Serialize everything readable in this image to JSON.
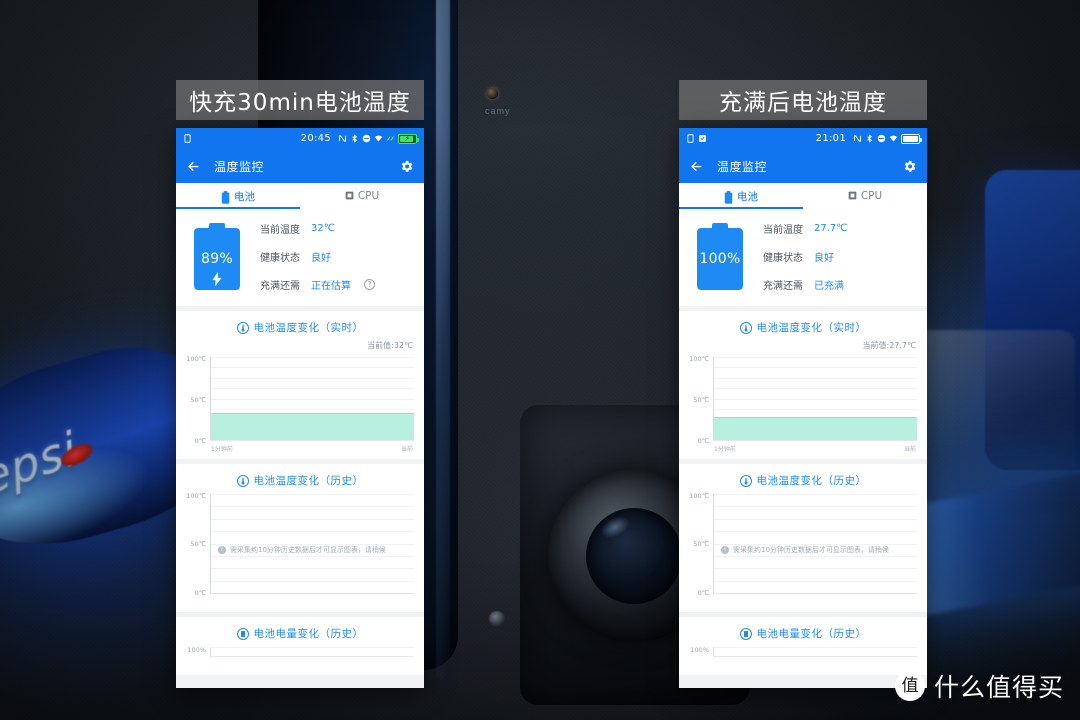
{
  "captions": {
    "left": "快充30min电池温度",
    "right": "充满后电池温度"
  },
  "phones": [
    {
      "id": "left",
      "statusbar": {
        "time": "20:45",
        "left_icons": [
          "sim-card-icon"
        ],
        "right_icons": [
          "nfc-icon",
          "bluetooth-icon",
          "do-not-disturb-icon",
          "wifi-icon",
          "signal-icon"
        ],
        "battery_state": "charging",
        "battery_level_text": "89"
      },
      "appbar": {
        "back_icon": "back-arrow-icon",
        "title": "温度监控",
        "settings_icon": "gear-icon"
      },
      "tabs": [
        {
          "label": "电池",
          "icon": "battery-icon",
          "active": true
        },
        {
          "label": "CPU",
          "icon": "cpu-icon",
          "active": false
        }
      ],
      "battery_card": {
        "percent": "89%",
        "charging": true,
        "rows": [
          {
            "label": "当前温度",
            "value": "32℃",
            "help": false
          },
          {
            "label": "健康状态",
            "value": "良好",
            "help": false
          },
          {
            "label": "充满还需",
            "value": "正在估算",
            "help": true,
            "help_glyph": "?"
          }
        ]
      },
      "realtime_chart": {
        "title": "电池温度变化（实时）",
        "title_icon": "thermometer-icon",
        "current_label": "当前值:32℃",
        "y_ticks": [
          "100℃",
          "50℃",
          "0℃"
        ],
        "x_ticks": {
          "left": "1分钟前",
          "right": "当前"
        }
      },
      "history_chart": {
        "title": "电池温度变化（历史）",
        "title_icon": "thermometer-icon",
        "y_ticks": [
          "100℃",
          "50℃",
          "0℃"
        ],
        "notice": "需采集约10分钟历史数据后才可显示图表，请稍候",
        "notice_icon": "info-icon"
      },
      "level_chart": {
        "title": "电池电量变化（历史）",
        "title_icon": "battery-icon",
        "y_ticks": [
          "100%"
        ]
      }
    },
    {
      "id": "right",
      "statusbar": {
        "time": "21:01",
        "left_icons": [
          "sim-card-icon",
          "save-icon"
        ],
        "right_icons": [
          "nfc-icon",
          "bluetooth-icon",
          "do-not-disturb-icon",
          "wifi-icon"
        ],
        "battery_state": "full",
        "battery_level_text": "100"
      },
      "appbar": {
        "back_icon": "back-arrow-icon",
        "title": "温度监控",
        "settings_icon": "gear-icon"
      },
      "tabs": [
        {
          "label": "电池",
          "icon": "battery-icon",
          "active": true
        },
        {
          "label": "CPU",
          "icon": "cpu-icon",
          "active": false
        }
      ],
      "battery_card": {
        "percent": "100%",
        "charging": false,
        "rows": [
          {
            "label": "当前温度",
            "value": "27.7℃",
            "help": false
          },
          {
            "label": "健康状态",
            "value": "良好",
            "help": false
          },
          {
            "label": "充满还需",
            "value": "已充满",
            "help": false
          }
        ]
      },
      "realtime_chart": {
        "title": "电池温度变化（实时）",
        "title_icon": "thermometer-icon",
        "current_label": "当前值:27.7℃",
        "y_ticks": [
          "100℃",
          "50℃",
          "0℃"
        ],
        "x_ticks": {
          "left": "1分钟前",
          "right": "当前"
        }
      },
      "history_chart": {
        "title": "电池温度变化（历史）",
        "title_icon": "thermometer-icon",
        "y_ticks": [
          "100℃",
          "50℃",
          "0℃"
        ],
        "notice": "需采集约10分钟历史数据后才可显示图表，请稍候",
        "notice_icon": "info-icon"
      },
      "level_chart": {
        "title": "电池电量变化（历史）",
        "title_icon": "battery-icon",
        "y_ticks": [
          "100%"
        ]
      }
    }
  ],
  "background": {
    "pepsi_label": "pepsi",
    "phone_brand": "camy"
  },
  "watermark": {
    "badge": "值",
    "text": "什么值得买"
  },
  "colors": {
    "accent_blue": "#1175f0",
    "value_blue": "#1e8bf5",
    "area_green": "#b8f0e0",
    "caption_bg": "#6e6e6e"
  },
  "chart_data": [
    {
      "type": "area",
      "title": "电池温度变化（实时）",
      "phone": "left",
      "xlabel": "",
      "ylabel": "℃",
      "ylim": [
        0,
        100
      ],
      "y_ticks": [
        0,
        50,
        100
      ],
      "x_ticks": [
        "1分钟前",
        "当前"
      ],
      "series": [
        {
          "name": "电池温度",
          "values": [
            32,
            32,
            32,
            32,
            32,
            32,
            32,
            32,
            32,
            32,
            32,
            32
          ]
        }
      ],
      "current_value": 32,
      "grid": true,
      "legend": "none"
    },
    {
      "type": "area",
      "title": "电池温度变化（实时）",
      "phone": "right",
      "xlabel": "",
      "ylabel": "℃",
      "ylim": [
        0,
        100
      ],
      "y_ticks": [
        0,
        50,
        100
      ],
      "x_ticks": [
        "1分钟前",
        "当前"
      ],
      "series": [
        {
          "name": "电池温度",
          "values": [
            27.7,
            27.7,
            27.7,
            27.7,
            27.7,
            27.7,
            27.7,
            27.7,
            27.7,
            27.7,
            27.7,
            27.7
          ]
        }
      ],
      "current_value": 27.7,
      "grid": true,
      "legend": "none"
    },
    {
      "type": "area",
      "title": "电池温度变化（历史）",
      "phone": "left",
      "ylim": [
        0,
        100
      ],
      "y_ticks": [
        0,
        50,
        100
      ],
      "series": [],
      "annotation": "需采集约10分钟历史数据后才可显示图表，请稍候",
      "grid": true,
      "legend": "none"
    },
    {
      "type": "area",
      "title": "电池温度变化（历史）",
      "phone": "right",
      "ylim": [
        0,
        100
      ],
      "y_ticks": [
        0,
        50,
        100
      ],
      "series": [],
      "annotation": "需采集约10分钟历史数据后才可显示图表，请稍候",
      "grid": true,
      "legend": "none"
    },
    {
      "type": "area",
      "title": "电池电量变化（历史）",
      "phone": "left",
      "ylim": [
        0,
        100
      ],
      "y_ticks": [
        100
      ],
      "series": [],
      "grid": true,
      "legend": "none"
    },
    {
      "type": "area",
      "title": "电池电量变化（历史）",
      "phone": "right",
      "ylim": [
        0,
        100
      ],
      "y_ticks": [
        100
      ],
      "series": [],
      "grid": true,
      "legend": "none"
    }
  ]
}
